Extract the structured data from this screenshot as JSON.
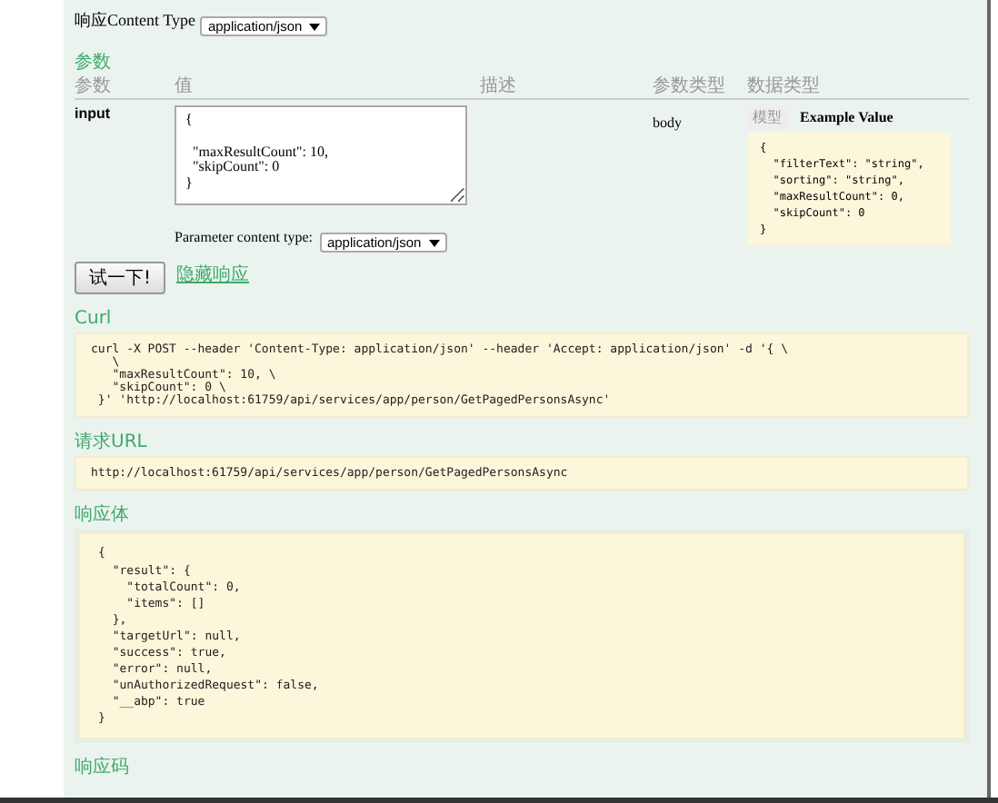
{
  "response_content_type": {
    "label": "响应Content Type",
    "value": "application/json"
  },
  "parameters": {
    "title": "参数",
    "columns": [
      "参数",
      "值",
      "描述",
      "参数类型",
      "数据类型"
    ],
    "rows": [
      {
        "name": "input",
        "value": "{\n\n  \"maxResultCount\": 10,\n  \"skipCount\": 0\n}",
        "param_type": "body",
        "model_tabs": [
          {
            "label": "模型",
            "selected": false
          },
          {
            "label": "Example Value",
            "selected": true
          }
        ],
        "example": "{\n  \"filterText\": \"string\",\n  \"sorting\": \"string\",\n  \"maxResultCount\": 0,\n  \"skipCount\": 0\n}"
      }
    ],
    "content_type": {
      "label": "Parameter content type:",
      "value": "application/json"
    }
  },
  "try_button": "试一下!",
  "hide_link": "隐藏响应",
  "curl": {
    "title": "Curl",
    "code": "curl -X POST --header 'Content-Type: application/json' --header 'Accept: application/json' -d '{ \\\n   \\\n   \"maxResultCount\": 10, \\\n   \"skipCount\": 0 \\\n }' 'http://localhost:61759/api/services/app/person/GetPagedPersonsAsync'"
  },
  "request_url": {
    "title": "请求URL",
    "code": "http://localhost:61759/api/services/app/person/GetPagedPersonsAsync"
  },
  "response_body": {
    "title": "响应体",
    "code": "{\n  \"result\": {\n    \"totalCount\": 0,\n    \"items\": []\n  },\n  \"targetUrl\": null,\n  \"success\": true,\n  \"error\": null,\n  \"unAuthorizedRequest\": false,\n  \"__abp\": true\n}"
  },
  "response_code": {
    "title": "响应码"
  }
}
